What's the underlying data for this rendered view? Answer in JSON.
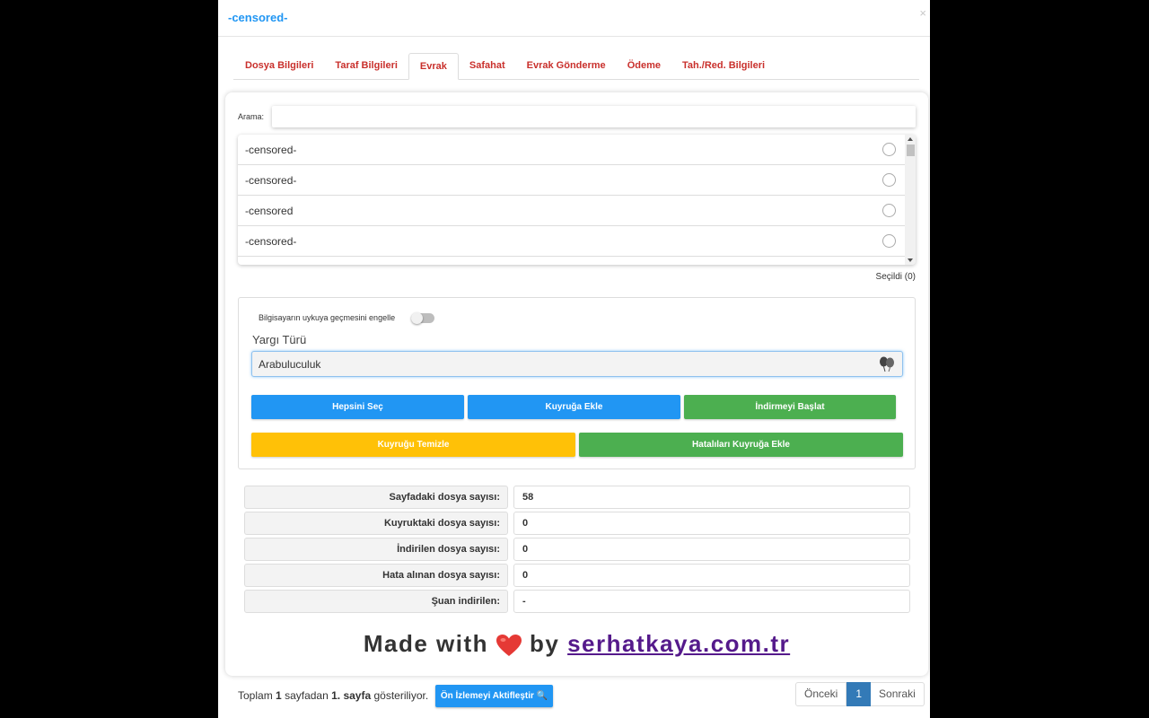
{
  "modal": {
    "title": "-censored-",
    "close": "×"
  },
  "tabs": [
    {
      "label": "Dosya Bilgileri"
    },
    {
      "label": "Taraf Bilgileri"
    },
    {
      "label": "Evrak",
      "active": true
    },
    {
      "label": "Safahat"
    },
    {
      "label": "Evrak Gönderme"
    },
    {
      "label": "Ödeme"
    },
    {
      "label": "Tah./Red. Bilgileri"
    }
  ],
  "search": {
    "label": "Arama:",
    "value": ""
  },
  "documents": [
    {
      "name": "-censored-"
    },
    {
      "name": "-censored-"
    },
    {
      "name": "-censored"
    },
    {
      "name": "-censored-"
    }
  ],
  "selected_text": "Seçildi (0)",
  "settings": {
    "sleep_label": "Bilgisayarın uykuya geçmesini engelle",
    "sleep_enabled": false,
    "yargi_label": "Yargı Türü",
    "yargi_value": "Arabuluculuk"
  },
  "buttons": {
    "select_all": "Hepsini Seç",
    "add_queue": "Kuyruğa Ekle",
    "start_download": "İndirmeyi Başlat",
    "clear_queue": "Kuyruğu Temizle",
    "add_errors": "Hatalıları Kuyruğa Ekle"
  },
  "stats": [
    {
      "label": "Sayfadaki dosya sayısı:",
      "value": "58"
    },
    {
      "label": "Kuyruktaki dosya sayısı:",
      "value": "0"
    },
    {
      "label": "İndirilen dosya sayısı:",
      "value": "0"
    },
    {
      "label": "Hata alınan dosya sayısı:",
      "value": "0"
    },
    {
      "label": "Şuan indirilen:",
      "value": "-"
    }
  ],
  "credit": {
    "made_with": "Made with",
    "by": "by",
    "link": "serhatkaya.com.tr"
  },
  "footer": {
    "prefix": "Toplam",
    "total_pages": "1",
    "middle": "sayfadan",
    "current_page": "1. sayfa",
    "suffix": "gösteriliyor.",
    "preview_button": "Ön İzlemeyi Aktifleştir",
    "prev": "Önceki",
    "page": "1",
    "next": "Sonraki"
  },
  "colors": {
    "primary": "#2196f3",
    "success": "#4caf50",
    "warning": "#ffc107",
    "tab_text": "#c9302c",
    "heart": "#e53935",
    "pager_active": "#337ab7"
  }
}
